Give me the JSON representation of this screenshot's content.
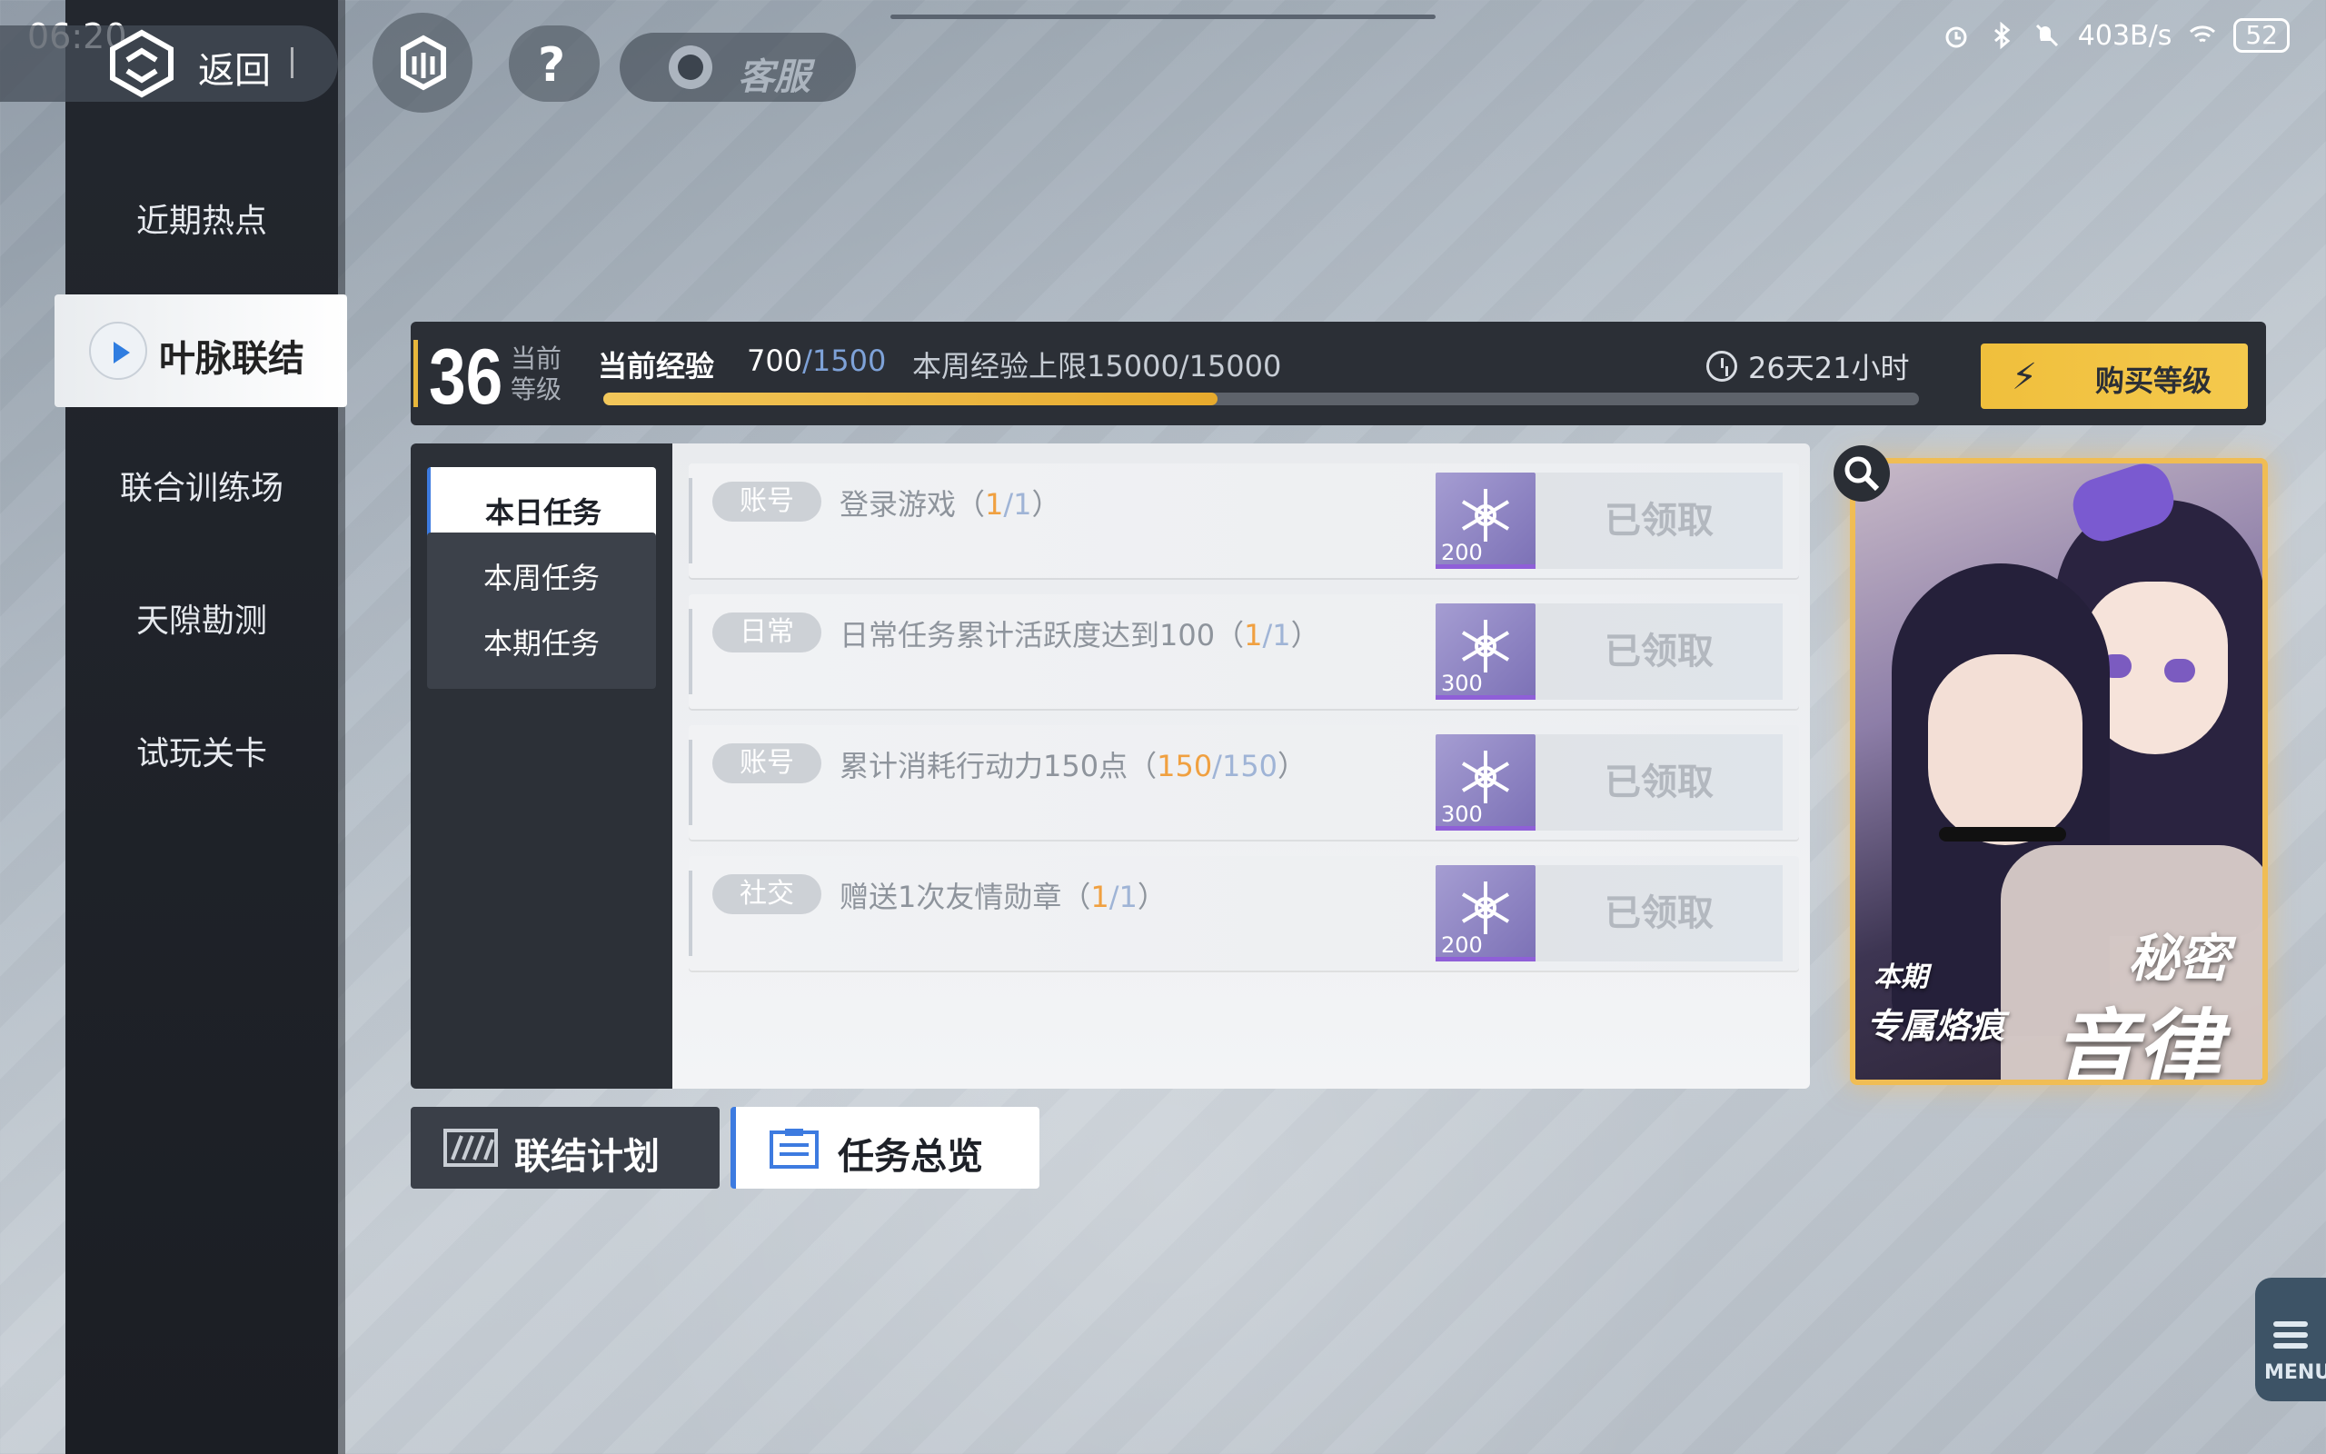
{
  "status_bar": {
    "time": "06:20",
    "network_speed": "403B/s",
    "battery": "52",
    "icons": [
      "alarm-icon",
      "bluetooth-icon",
      "mute-icon",
      "wifi-icon",
      "battery-icon"
    ]
  },
  "top_nav": {
    "back_label": "返回",
    "service_label": "客服",
    "help_label": "?"
  },
  "sidebar": {
    "items": [
      {
        "label": "近期热点",
        "active": false
      },
      {
        "label": "叶脉联结",
        "active": true
      },
      {
        "label": "联合训练场",
        "active": false
      },
      {
        "label": "天隙勘测",
        "active": false
      },
      {
        "label": "试玩关卡",
        "active": false
      }
    ]
  },
  "level": {
    "value": "36",
    "caption": "当前等级",
    "exp_label": "当前经验",
    "exp_current": "700",
    "exp_max": "/1500",
    "exp_fraction": 0.467,
    "weekly_cap": "本周经验上限15000/15000",
    "timer": "26天21小时",
    "buy_label": "购买等级"
  },
  "tabs": [
    {
      "label": "本日任务",
      "active": true
    },
    {
      "label": "本周任务",
      "active": false
    },
    {
      "label": "本期任务",
      "active": false
    }
  ],
  "tasks": [
    {
      "tag": "账号",
      "title": "登录游戏（",
      "prog_a": "1",
      "prog_b": "/1",
      "close": "）",
      "reward_qty": "200",
      "status": "已领取"
    },
    {
      "tag": "日常",
      "title": "日常任务累计活跃度达到100（",
      "prog_a": "1",
      "prog_b": "/1",
      "close": "）",
      "reward_qty": "300",
      "status": "已领取"
    },
    {
      "tag": "账号",
      "title": "累计消耗行动力150点（",
      "prog_a": "150",
      "prog_b": "/150",
      "close": "）",
      "reward_qty": "300",
      "status": "已领取"
    },
    {
      "tag": "社交",
      "title": "赠送1次友情勋章（",
      "prog_a": "1",
      "prog_b": "/1",
      "close": "）",
      "reward_qty": "200",
      "status": "已领取"
    }
  ],
  "bottom_buttons": {
    "plan_label": "联结计划",
    "overview_label": "任务总览"
  },
  "promo": {
    "sub_label": "本期",
    "tag_label": "专属烙痕",
    "title_line1": "秘密",
    "title_line2": "音律"
  },
  "menu": {
    "label": "MENU"
  },
  "colors": {
    "accent_gold": "#f0bf3c",
    "accent_blue": "#3d7be0",
    "progress_orange": "#f0a040"
  }
}
